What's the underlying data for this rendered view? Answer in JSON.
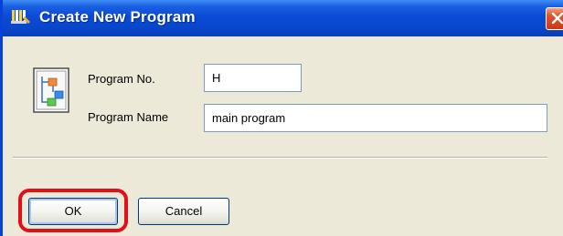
{
  "window": {
    "title": "Create New Program",
    "title_icon": "program-editor-icon",
    "close_icon": "close-icon"
  },
  "form": {
    "icon": "program-flow-icon",
    "program_no": {
      "label": "Program No.",
      "value": "H"
    },
    "program_name": {
      "label": "Program Name",
      "value": "main program"
    }
  },
  "buttons": {
    "ok_label": "OK",
    "cancel_label": "Cancel"
  },
  "colors": {
    "titlebar": "#0a4ad6",
    "window_bg": "#ece9d8",
    "close_button": "#d94a20",
    "highlight": "#e0101a",
    "field_border": "#7f9db9"
  }
}
